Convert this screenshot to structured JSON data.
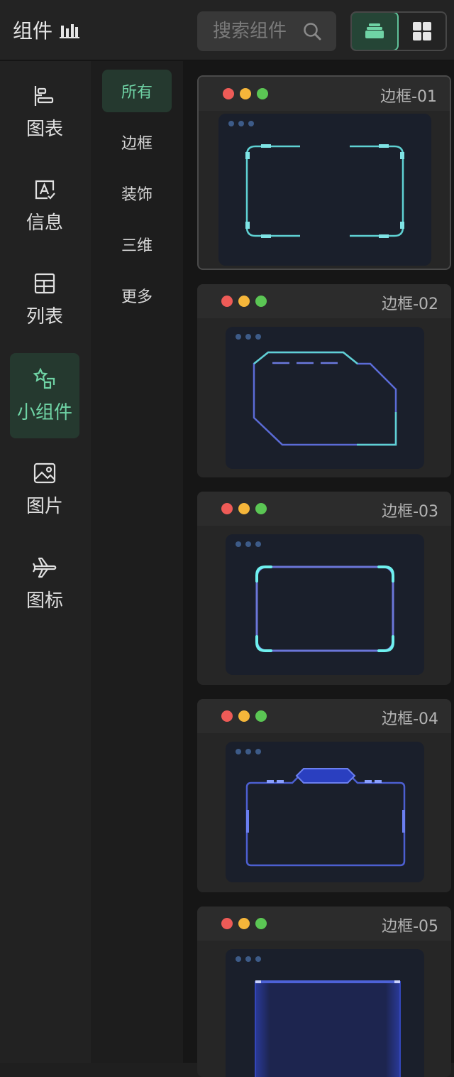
{
  "header": {
    "title": "组件",
    "title_icon": "bar-chart-icon",
    "search_placeholder": "搜索组件",
    "view_modes": [
      "stack-view",
      "grid-view"
    ]
  },
  "left_nav": {
    "items": [
      {
        "label": "图表",
        "icon": "chart-icon",
        "active": false
      },
      {
        "label": "信息",
        "icon": "info-text-icon",
        "active": false
      },
      {
        "label": "列表",
        "icon": "table-icon",
        "active": false
      },
      {
        "label": "小组件",
        "icon": "widget-icon",
        "active": true
      },
      {
        "label": "图片",
        "icon": "image-icon",
        "active": false
      },
      {
        "label": "图标",
        "icon": "plane-icon",
        "active": false
      }
    ]
  },
  "sub_nav": {
    "items": [
      {
        "label": "所有",
        "active": true
      },
      {
        "label": "边框",
        "active": false
      },
      {
        "label": "装饰",
        "active": false
      },
      {
        "label": "三维",
        "active": false
      },
      {
        "label": "更多",
        "active": false
      }
    ]
  },
  "cards": [
    {
      "title": "边框-01"
    },
    {
      "title": "边框-02"
    },
    {
      "title": "边框-03"
    },
    {
      "title": "边框-04"
    },
    {
      "title": "边框-05"
    }
  ],
  "colors": {
    "accent": "#6fd3a5",
    "dot_red": "#ee5b57",
    "dot_yellow": "#f5b63a",
    "dot_green": "#5bc654",
    "cyan": "#5fd1d3",
    "indigo": "#5b6bd6"
  }
}
